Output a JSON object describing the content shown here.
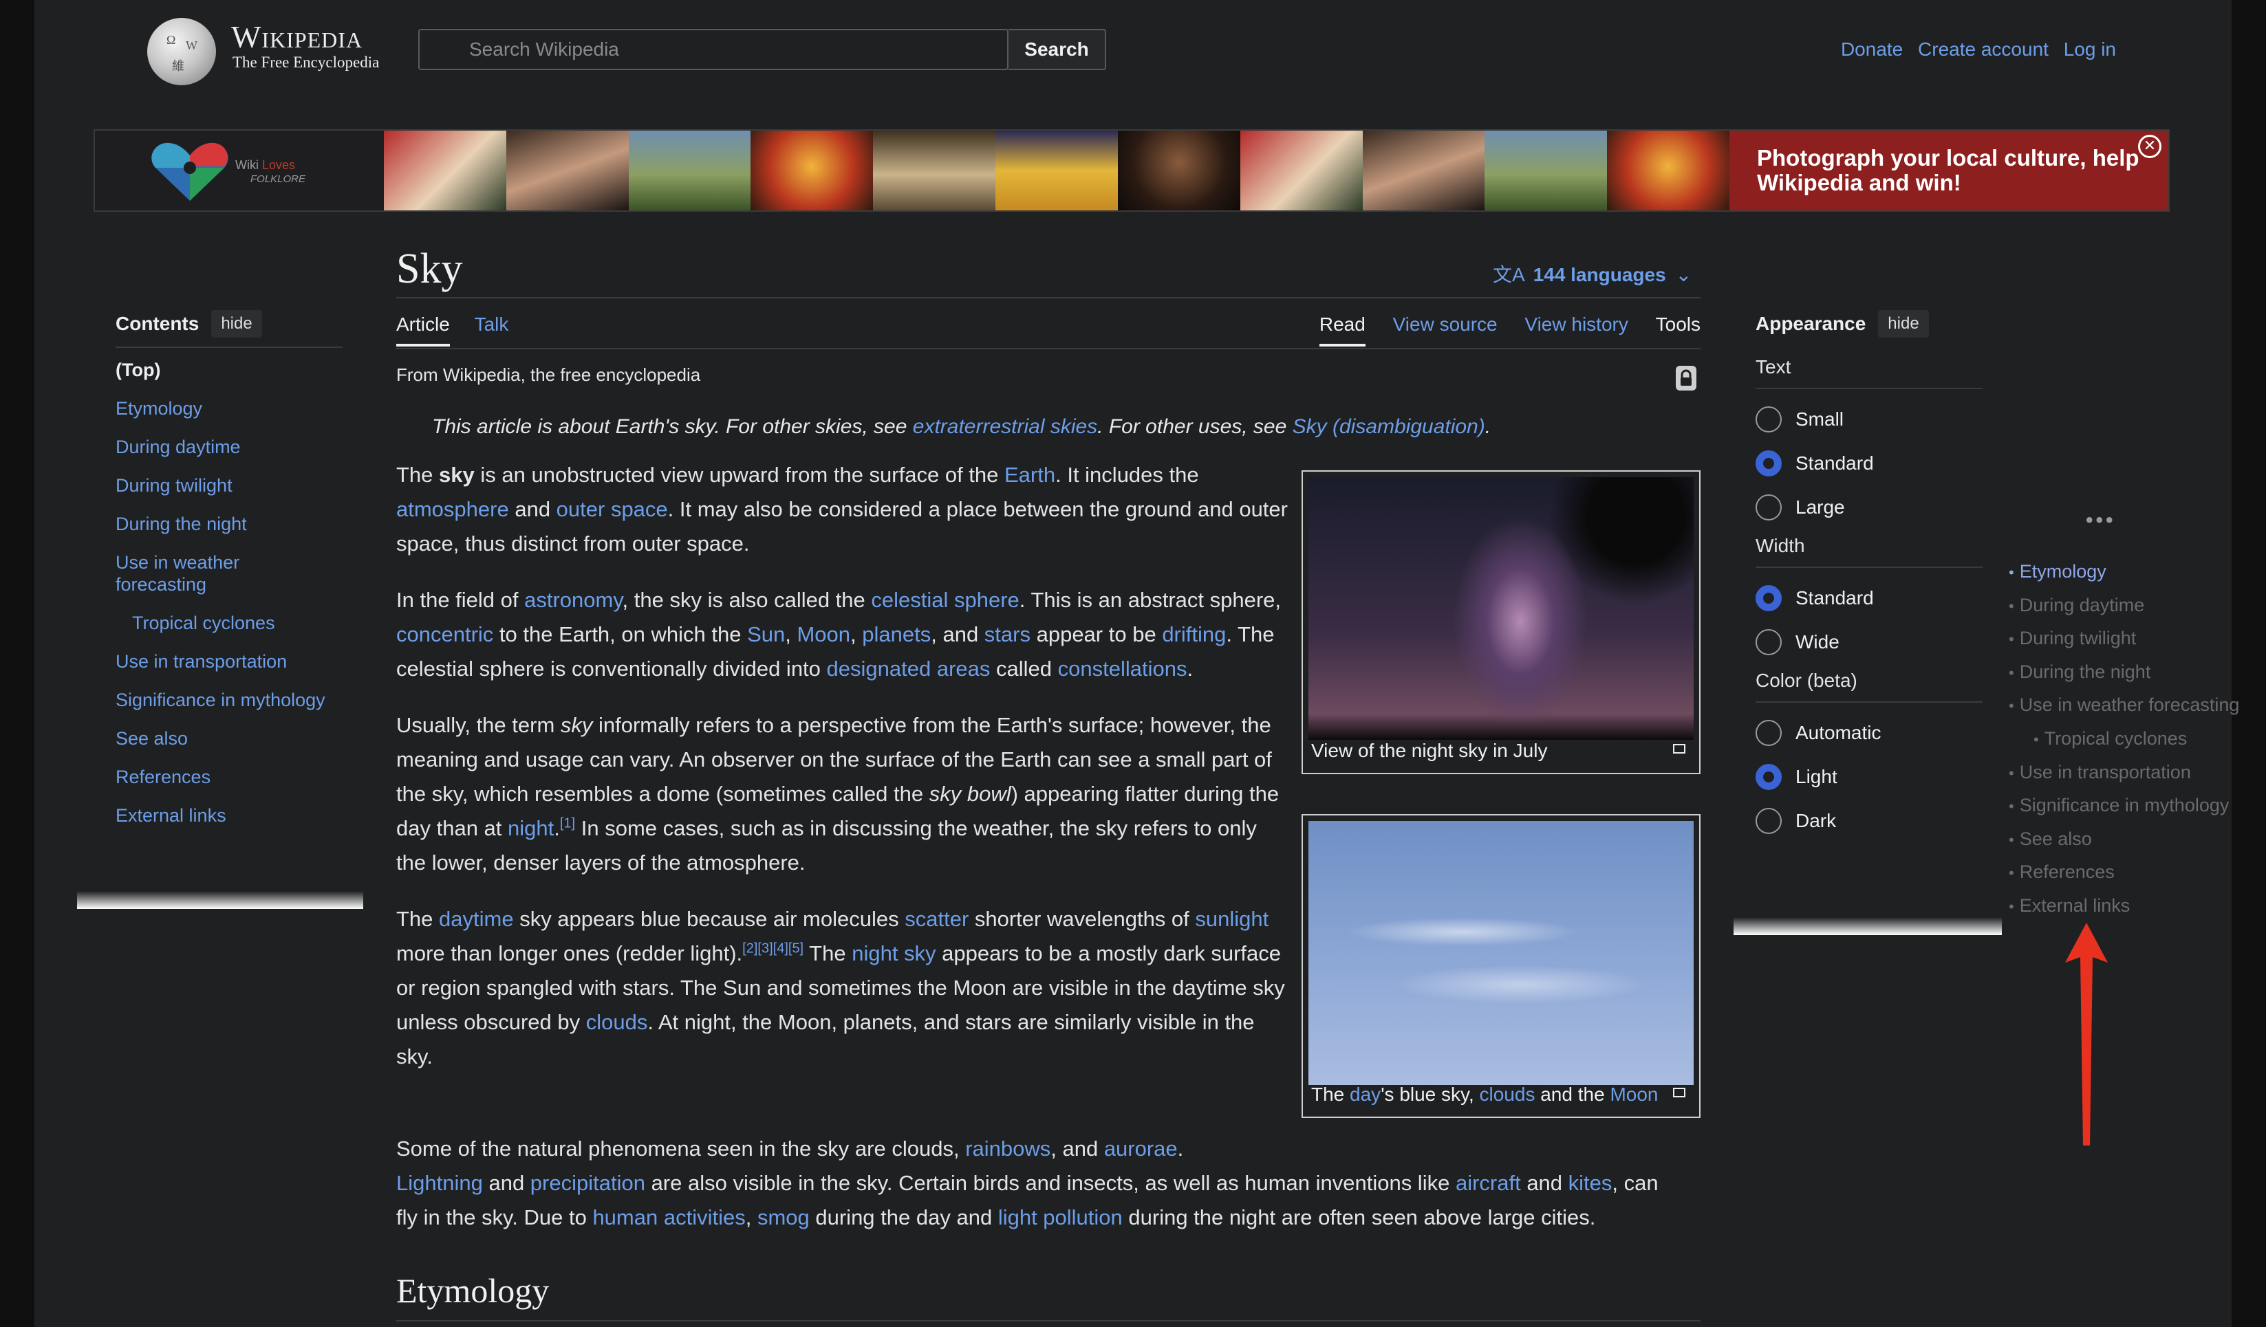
{
  "header": {
    "wordmark_title": "Wikipedia",
    "wordmark_tagline": "The Free Encyclopedia",
    "search_placeholder": "Search Wikipedia",
    "search_button": "Search",
    "user_links": [
      "Donate",
      "Create account",
      "Log in"
    ]
  },
  "banner": {
    "logo_text_1": "Wiki",
    "logo_text_1b": "Loves",
    "logo_text_2": "FOLKLORE",
    "cta_text": "Photograph your local culture, help Wikipedia and win!",
    "close_icon": "✕"
  },
  "toc": {
    "title": "Contents",
    "hide_label": "hide",
    "items": [
      {
        "label": "(Top)",
        "level": 0
      },
      {
        "label": "Etymology",
        "level": 1
      },
      {
        "label": "During daytime",
        "level": 1
      },
      {
        "label": "During twilight",
        "level": 1
      },
      {
        "label": "During the night",
        "level": 1
      },
      {
        "label": "Use in weather forecasting",
        "level": 1
      },
      {
        "label": "Tropical cyclones",
        "level": 2
      },
      {
        "label": "Use in transportation",
        "level": 1
      },
      {
        "label": "Significance in mythology",
        "level": 1
      },
      {
        "label": "See also",
        "level": 1
      },
      {
        "label": "References",
        "level": 1
      },
      {
        "label": "External links",
        "level": 1
      }
    ]
  },
  "article": {
    "title": "Sky",
    "languages": "144 languages",
    "tabs_left": [
      "Article",
      "Talk"
    ],
    "tabs_right": [
      "Read",
      "View source",
      "View history",
      "Tools"
    ],
    "from_wiki": "From Wikipedia, the free encyclopedia",
    "hatnote_1": "This article is about Earth's sky. For other skies, see ",
    "hatnote_link_1": "extraterrestrial skies",
    "hatnote_2": ". For other uses, see ",
    "hatnote_link_2": "Sky (disambiguation)",
    "hatnote_3": ".",
    "section_heading": "Etymology"
  },
  "figures": [
    {
      "caption": "View of the night sky in July"
    },
    {
      "caption_parts": [
        "The ",
        "day",
        "'s blue sky, ",
        "clouds",
        " and the ",
        "Moon"
      ]
    }
  ],
  "appearance": {
    "title": "Appearance",
    "hide_label": "hide",
    "text_label": "Text",
    "text_options": [
      "Small",
      "Standard",
      "Large"
    ],
    "text_selected": "Standard",
    "width_label": "Width",
    "width_options": [
      "Standard",
      "Wide"
    ],
    "width_selected": "Standard",
    "color_label": "Color (beta)",
    "color_options": [
      "Automatic",
      "Light",
      "Dark"
    ],
    "color_selected": "Light"
  },
  "pinned_toc": {
    "dots": "•••",
    "items": [
      {
        "label": "Etymology",
        "level": 1,
        "current": true
      },
      {
        "label": "During daytime",
        "level": 1
      },
      {
        "label": "During twilight",
        "level": 1
      },
      {
        "label": "During the night",
        "level": 1
      },
      {
        "label": "Use in weather forecasting",
        "level": 1
      },
      {
        "label": "Tropical cyclones",
        "level": 2
      },
      {
        "label": "Use in transportation",
        "level": 1
      },
      {
        "label": "Significance in mythology",
        "level": 1
      },
      {
        "label": "See also",
        "level": 1
      },
      {
        "label": "References",
        "level": 1
      },
      {
        "label": "External links",
        "level": 1
      }
    ]
  },
  "colors": {
    "link": "#6d9ee8",
    "background": "#1f2022",
    "banner_red": "#8e1f1f",
    "radio_on": "#3a63d6",
    "arrow": "#e8321f"
  }
}
